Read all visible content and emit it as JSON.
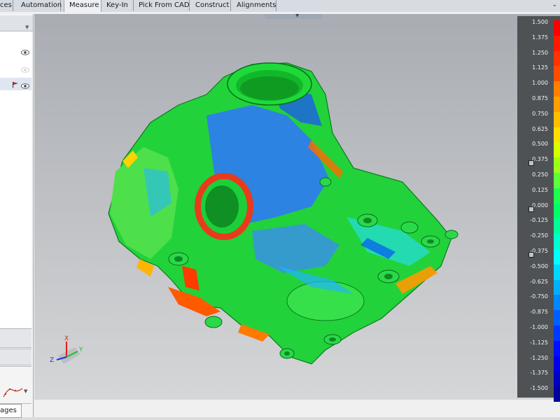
{
  "ribbon": {
    "tabs": [
      {
        "label": "ces"
      },
      {
        "label": "Automation"
      },
      {
        "label": "Measure"
      },
      {
        "label": "Key-In"
      },
      {
        "label": "Pick From CAD"
      },
      {
        "label": "Construct"
      },
      {
        "label": "Alignments"
      }
    ],
    "collapse_glyph": "⌄"
  },
  "bottom_tab": {
    "label": "ages"
  },
  "color_scale": {
    "labels": [
      "1.500",
      "1.375",
      "1.250",
      "1.125",
      "1.000",
      "0.875",
      "0.750",
      "0.625",
      "0.500",
      "0.375",
      "0.250",
      "0.125",
      "0.000",
      "-0.125",
      "-0.250",
      "-0.375",
      "-0.500",
      "-0.625",
      "-0.750",
      "-0.875",
      "-1.000",
      "-1.125",
      "-1.250",
      "-1.375",
      "-1.500"
    ],
    "colors": [
      "#ff0000",
      "#ff1a00",
      "#ff3300",
      "#ff4d00",
      "#ff7f00",
      "#ff9f00",
      "#ffbf00",
      "#ffdf00",
      "#d6ff00",
      "#9bff1a",
      "#5cff3a",
      "#1aff50",
      "#00ff66",
      "#00ff99",
      "#00ffcc",
      "#00ffff",
      "#00d8ff",
      "#00b0ff",
      "#0088ff",
      "#0060ff",
      "#0038ff",
      "#0010ff",
      "#0000e6",
      "#0000c0",
      "#00009a"
    ]
  },
  "triad": {
    "x_label": "X",
    "y_label": "Y",
    "z_label": "Z"
  },
  "icons": {
    "eye": "eye-icon",
    "flag": "flag-icon",
    "dropdown": "chevron-down-icon"
  }
}
